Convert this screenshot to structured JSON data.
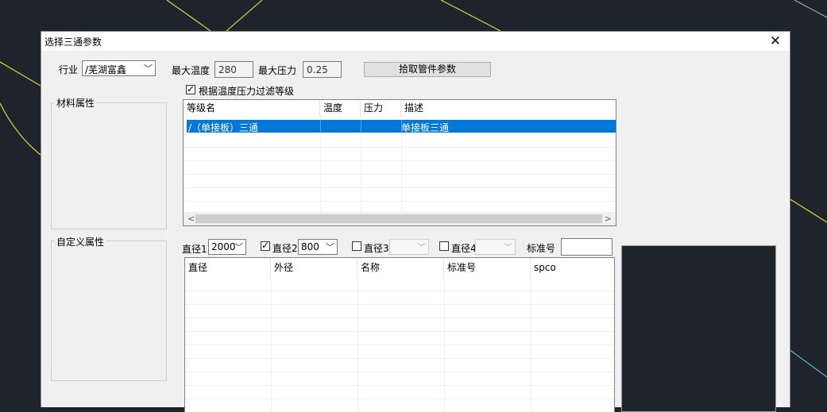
{
  "dialog": {
    "title": "选择三通参数",
    "close_glyph": "✕"
  },
  "industry": {
    "label": "行业",
    "value": "/芜湖富鑫"
  },
  "max_temp": {
    "label": "最大温度",
    "value": "280"
  },
  "max_pressure": {
    "label": "最大压力",
    "value": "0.25"
  },
  "pick_button": "拾取管件参数",
  "filter_checkbox": {
    "label": "根据温度压力过滤等级",
    "checked": true
  },
  "groups": {
    "material": "材料属性",
    "custom": "自定义属性"
  },
  "grade_table": {
    "columns": [
      "等级名",
      "温度",
      "压力",
      "描述"
    ],
    "selected_row": {
      "name": "/（单接板）三通",
      "temp": "",
      "pressure": "",
      "desc": "单接板三通"
    }
  },
  "diameter_filters": {
    "d1": {
      "label": "直径1",
      "value": "2000"
    },
    "d2": {
      "label": "直径2",
      "value": "800",
      "checked": true
    },
    "d3": {
      "label": "直径3",
      "value": "",
      "checked": false
    },
    "d4": {
      "label": "直径4",
      "value": "",
      "checked": false
    },
    "standard": {
      "label": "标准号",
      "value": ""
    }
  },
  "part_table": {
    "columns": [
      "直径",
      "外径",
      "名称",
      "标准号",
      "spco"
    ]
  },
  "icons": {
    "checkbox_checked": "✓",
    "dropdown": "﹀",
    "scroll_left": "<",
    "scroll_right": ">"
  }
}
